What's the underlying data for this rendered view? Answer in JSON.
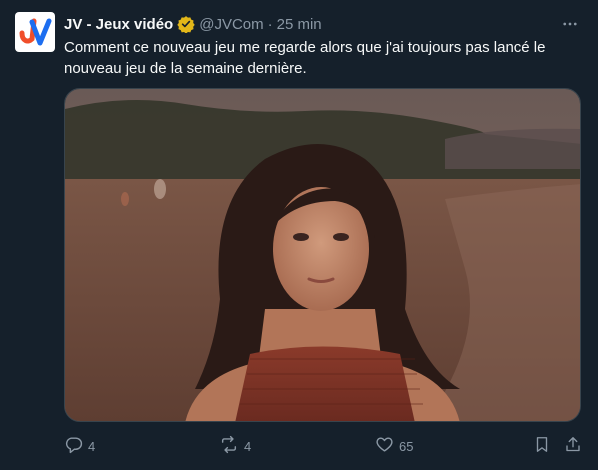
{
  "tweet": {
    "author_name": "JV - Jeux vidéo",
    "author_handle": "@JVCom",
    "separator": "·",
    "time_ago": "25 min",
    "avatar_text": "JV",
    "text": "Comment ce nouveau jeu me regarde alors que j'ai toujours pas lancé le nouveau jeu de la semaine dernière.",
    "verified": true,
    "verified_color": "#e2b719",
    "accent": "#f7f9f9",
    "muted": "#8b98a5"
  },
  "actions": {
    "replies": "4",
    "reposts": "4",
    "likes": "65",
    "views": ""
  },
  "icons": [
    "verified-badge-icon",
    "more-icon",
    "reply-icon",
    "repost-icon",
    "like-icon",
    "bookmark-icon",
    "share-icon"
  ]
}
